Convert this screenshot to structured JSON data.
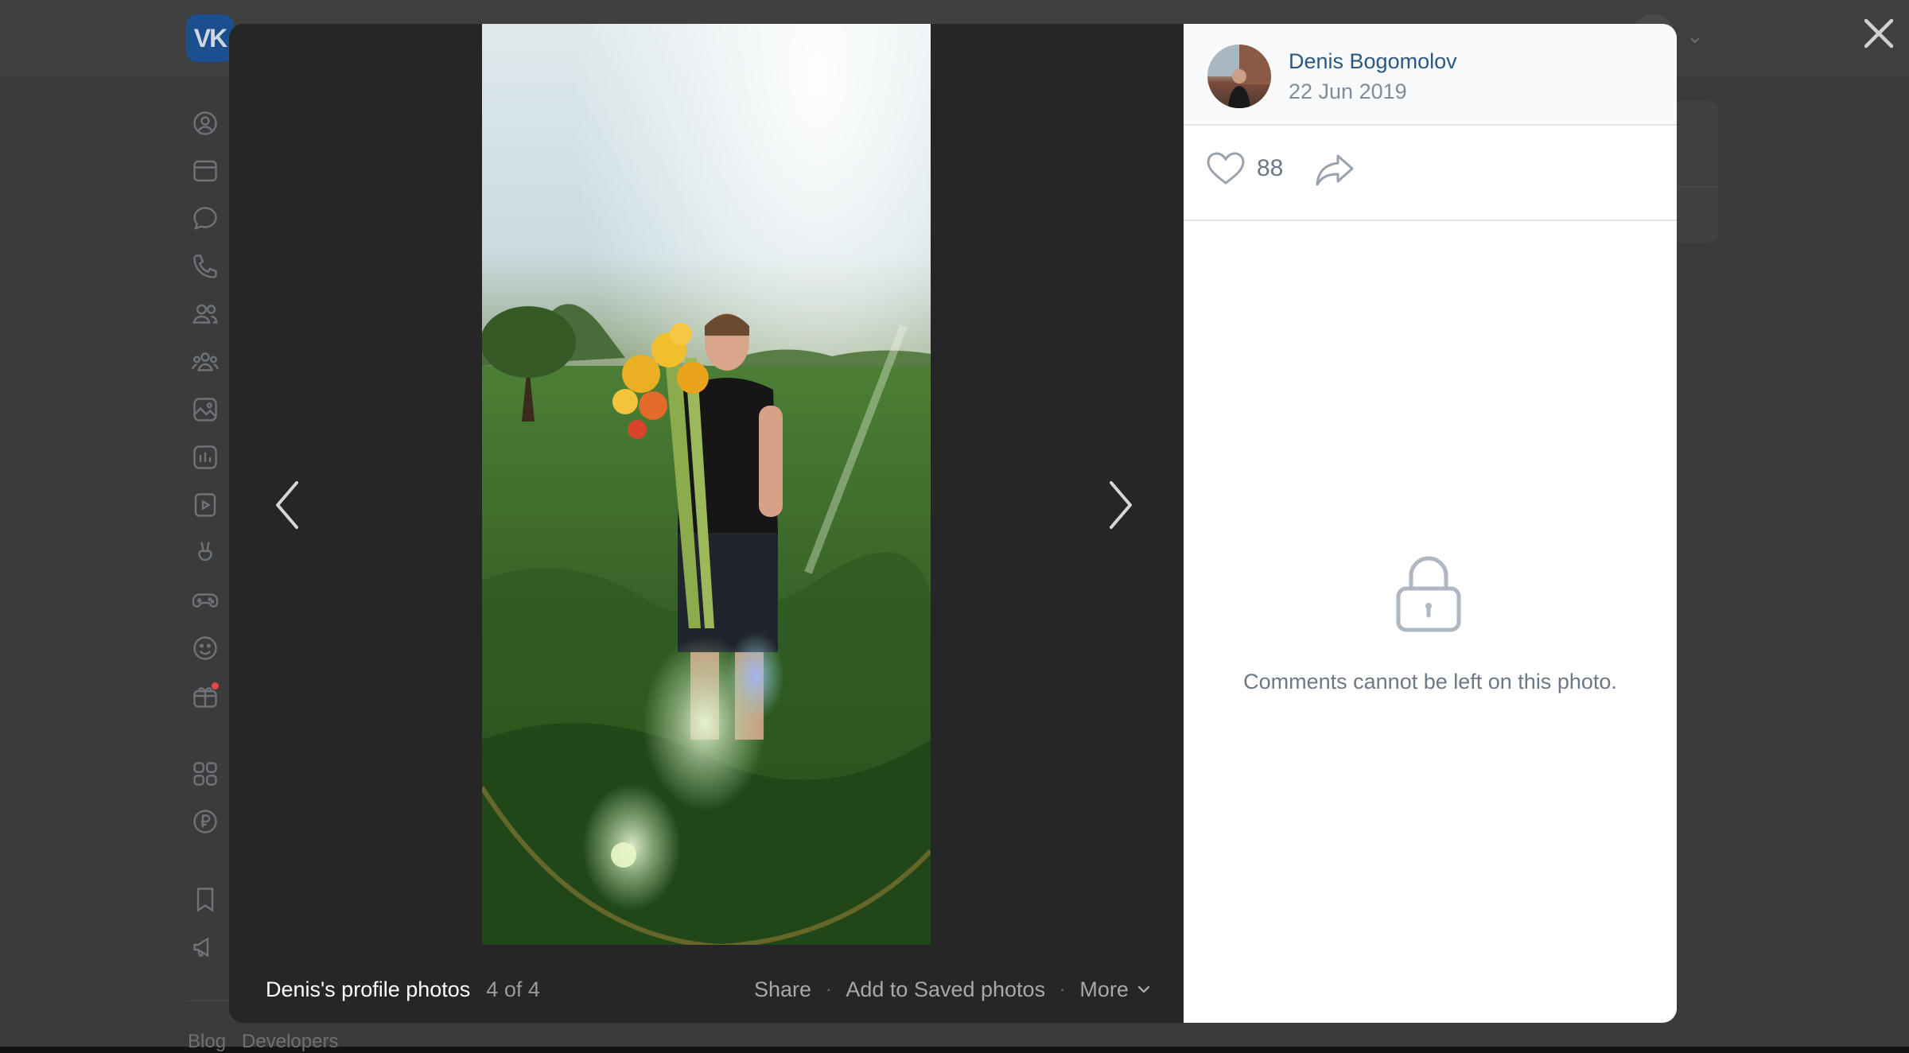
{
  "background_page": {
    "logo_text": "VK",
    "footer_links": [
      "Blog",
      "Developers"
    ],
    "sidebar_icons": [
      "profile-icon",
      "news-icon",
      "messages-icon",
      "calls-icon",
      "friends-icon",
      "communities-icon",
      "photos-icon",
      "music-icon",
      "video-icon",
      "clips-icon",
      "games-icon",
      "stickers-icon",
      "gifts-icon",
      "services-icon",
      "vk-pay-icon",
      "bookmarks-icon",
      "ads-icon"
    ]
  },
  "viewer": {
    "album_title": "Denis's profile photos",
    "photo_counter": "4 of 4",
    "actions": {
      "share": "Share",
      "save": "Add to Saved photos",
      "more": "More"
    },
    "author": {
      "name": "Denis Bogomolov",
      "date": "22 Jun 2019"
    },
    "likes": "88",
    "comments_disabled_text": "Comments cannot be left on this photo."
  },
  "colors": {
    "link": "#2a5885",
    "muted": "#818c99",
    "viewer_bg": "#262626"
  }
}
